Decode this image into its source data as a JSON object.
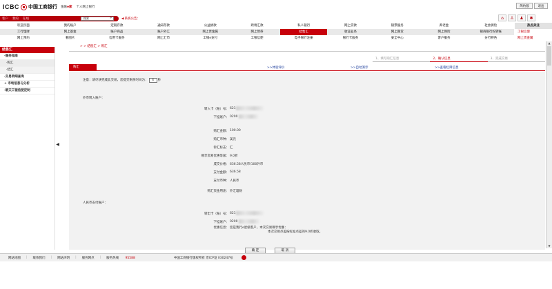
{
  "header": {
    "logo_text": "ICBC",
    "bank_name": "中国工商银行",
    "sub_brand_prefix": "金融",
    "sub_brand_suffix": "e家",
    "sub_title": "个人网上银行",
    "btn_simple": "简约版",
    "btn_exit": "退出"
  },
  "navstrip": {
    "tabs": [
      "客户",
      "我的",
      "在线"
    ],
    "search_value": "搜索",
    "search_btn": "»",
    "notice_label": "系统公告："
  },
  "icons": [
    "home-icon",
    "user-icon",
    "people-icon",
    "settings-icon"
  ],
  "menu": {
    "row0": [
      "欢迎页面",
      "我的账户",
      "定期存款",
      "通知存款",
      "公益捐款",
      "跨境汇款",
      "私人银行",
      "网上贷款",
      "银票服务",
      "养老金",
      "社会保险"
    ],
    "row1": [
      "工行理财",
      "网上基金",
      "账户商品",
      "账户外汇",
      "网上贵金属",
      "网上债券",
      "结售汇",
      "收证业务",
      "网上期货",
      "网上保险",
      "银商银行权转账"
    ],
    "row2": [
      "网上预约",
      "看图片",
      "信用卡服务",
      "网上汇市",
      "工银e支付",
      "工银信使",
      "电子银行注册",
      "银行卡服务",
      "安全中心",
      "客户服务",
      "分行特色"
    ],
    "active": "结售汇",
    "hot_title": "热点关注",
    "hot_items": [
      "工银信使",
      "网上贵金属"
    ]
  },
  "sidebar": {
    "head": "结售汇",
    "items": [
      {
        "label": "·服务指南",
        "cls": "bold"
      },
      {
        "label": "·购汇",
        "cls": "sub sel"
      },
      {
        "label": "·结汇",
        "cls": "sub"
      },
      {
        "label": "·交易明细查询",
        "cls": "bold"
      },
      {
        "label": "+ 市场信息与分析",
        "cls": "bold"
      },
      {
        "label": "·朝天工银信使定制",
        "cls": "bold"
      }
    ]
  },
  "breadcrumb": "> > 结售汇 > 购汇",
  "steps": [
    "1、填写购汇信息",
    "2、确认信息",
    "3、完成交易"
  ],
  "tab": {
    "active": "购汇",
    "link1": "体验评价",
    "link2": "自动演示",
    "link3": "查看栏目信息"
  },
  "form": {
    "notice_prefix": "注意：请尽快完成此交易，您提交剩余时间为：",
    "countdown": "4",
    "notice_suffix": "秒",
    "out_section": "外币转入账户：",
    "fields": [
      {
        "label": "转入卡（账）号：",
        "value": "621"
      },
      {
        "label": "下挂账户：",
        "value": "0200"
      },
      {
        "label": "购汇金额：",
        "value": "100.00"
      },
      {
        "label": "购汇币种：",
        "value": "美元"
      },
      {
        "label": "钞汇标志：",
        "value": "汇"
      },
      {
        "label": "尊享贸易优惠等级：",
        "value": "9.0折"
      },
      {
        "label": "成交价格：",
        "value": "636.58人民币/100外币"
      },
      {
        "label": "支付金额：",
        "value": "636.58"
      },
      {
        "label": "支付币种：",
        "value": "人民币"
      },
      {
        "label": "购汇资金用途：",
        "value": "外汇理财"
      }
    ],
    "rmb_section": "人民币支付账户：",
    "pay_fields": [
      {
        "label": "转出卡（账）号：",
        "value": "621"
      },
      {
        "label": "下挂账户：",
        "value": "0200"
      },
      {
        "label": "优惠信息：",
        "value": "您是我行e星级客户，本次交易尊享优惠："
      }
    ],
    "promo_line2": "本次交易点差按标准点差的9.0折收取。",
    "btn_ok": "确 定",
    "btn_cancel": "取 消"
  },
  "footer": {
    "items": [
      "网站地图",
      "联系我们",
      "网站声明",
      "服务网点"
    ],
    "hotline_label": "服务热线",
    "hotline": "95588",
    "copyright": "中国工商银行版权所有  京ICP证 030247号"
  }
}
